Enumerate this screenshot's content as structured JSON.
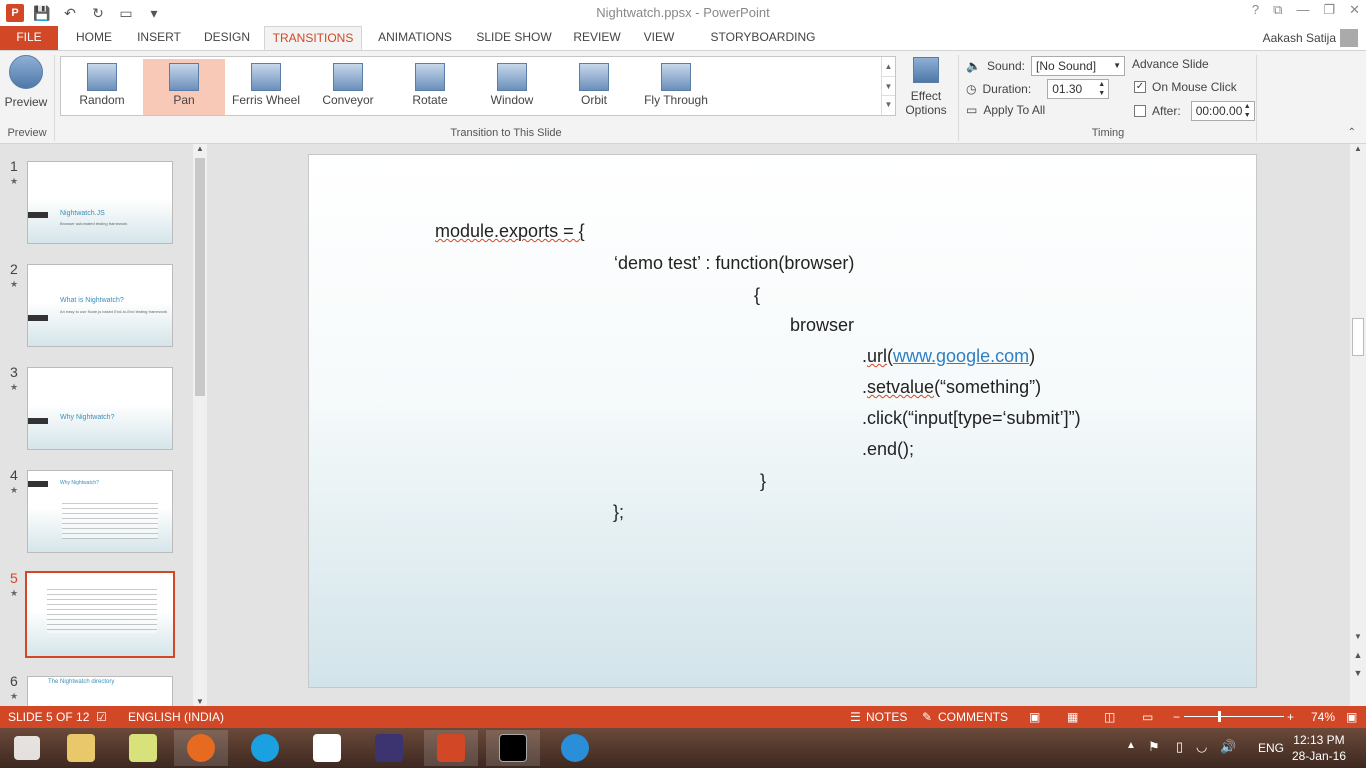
{
  "window": {
    "title": "Nightwatch.ppsx - PowerPoint",
    "controls": [
      "?",
      "⧉",
      "—",
      "❐",
      "✕"
    ]
  },
  "ribbon_tabs": [
    {
      "label": "FILE"
    },
    {
      "label": "HOME"
    },
    {
      "label": "INSERT"
    },
    {
      "label": "DESIGN"
    },
    {
      "label": "TRANSITIONS"
    },
    {
      "label": "ANIMATIONS"
    },
    {
      "label": "SLIDE SHOW"
    },
    {
      "label": "REVIEW"
    },
    {
      "label": "VIEW"
    },
    {
      "label": "STORYBOARDING"
    }
  ],
  "user": {
    "name": "Aakash Satija"
  },
  "ribbon": {
    "preview_label": "Preview",
    "preview_group": "Preview",
    "transitions": [
      {
        "label": "Random",
        "icon": "random-icon"
      },
      {
        "label": "Pan",
        "icon": "pan-icon",
        "selected": true
      },
      {
        "label": "Ferris Wheel",
        "icon": "ferris-wheel-icon"
      },
      {
        "label": "Conveyor",
        "icon": "conveyor-icon"
      },
      {
        "label": "Rotate",
        "icon": "rotate-icon"
      },
      {
        "label": "Window",
        "icon": "window-icon"
      },
      {
        "label": "Orbit",
        "icon": "orbit-icon"
      },
      {
        "label": "Fly Through",
        "icon": "fly-through-icon"
      }
    ],
    "effect_options_line1": "Effect",
    "effect_options_line2": "Options",
    "transition_group": "Transition to This Slide",
    "sound_label": "Sound:",
    "sound_value": "[No Sound]",
    "duration_label": "Duration:",
    "duration_value": "01.30",
    "apply_all_label": "Apply To All",
    "advance_label": "Advance Slide",
    "on_click_label": "On Mouse Click",
    "after_label": "After:",
    "after_value": "00:00.00",
    "timing_group": "Timing"
  },
  "thumbnails": [
    {
      "num": "1",
      "title": "Nightwatch.JS",
      "subtitle": "Browser automated testing framework"
    },
    {
      "num": "2",
      "title": "What is Nightwatch?",
      "subtitle": "An easy to use Node.js based End-to-End testing framework"
    },
    {
      "num": "3",
      "title": "Why Nightwatch?",
      "subtitle": ""
    },
    {
      "num": "4",
      "title": "Why Nightwatch?",
      "subtitle": ""
    },
    {
      "num": "5",
      "title": "",
      "subtitle": ""
    },
    {
      "num": "6",
      "title": "The Nightwatch directory",
      "subtitle": ""
    }
  ],
  "slide": {
    "line1": "module.exports = {",
    "line2": "‘demo test’ : function(browser)",
    "line3": "{",
    "line4": "browser",
    "line5_prefix": ".",
    "line5_squiggle": "url",
    "line5_open": "(",
    "line5_link": "www.google.com",
    "line5_close": ")",
    "line6_prefix": ".",
    "line6_squiggle": "setvalue",
    "line6_rest": "(“something”)",
    "line7": ".click(“input[type=‘submit’]”)",
    "line8": ".end();",
    "line9": "}",
    "line10": "};"
  },
  "status": {
    "slide": "SLIDE 5 OF 12",
    "language": "ENGLISH (INDIA)",
    "notes": "NOTES",
    "comments": "COMMENTS",
    "zoom": "74%"
  },
  "taskbar": {
    "lang": "ENG",
    "time": "12:13 PM",
    "date": "28-Jan-16"
  },
  "colors": {
    "accent": "#d24726",
    "title_blue": "#3a8fb7"
  }
}
